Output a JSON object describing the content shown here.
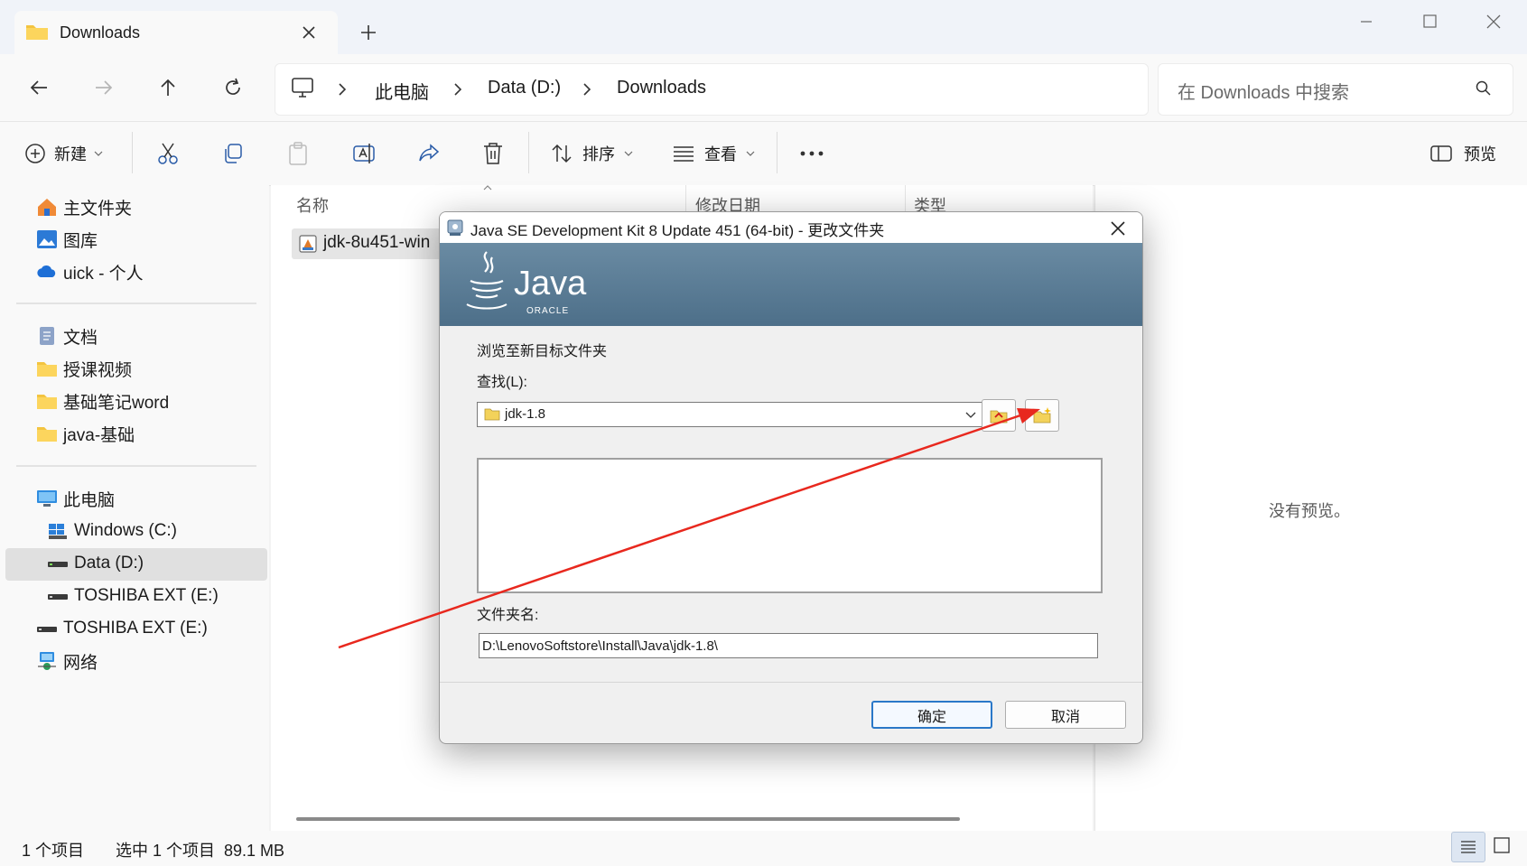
{
  "tab": {
    "title": "Downloads"
  },
  "breadcrumb": [
    "此电脑",
    "Data (D:)",
    "Downloads"
  ],
  "search": {
    "placeholder": "在 Downloads 中搜索"
  },
  "toolbar": {
    "new_label": "新建",
    "sort_label": "排序",
    "view_label": "查看",
    "preview_label": "预览"
  },
  "sidebar": {
    "quick": [
      "主文件夹",
      "图库",
      "uick - 个人"
    ],
    "pinned": [
      "文档",
      "授课视频",
      "基础笔记word",
      "java-基础"
    ],
    "this_pc": "此电脑",
    "drives": [
      "Windows (C:)",
      "Data (D:)",
      "TOSHIBA EXT (E:)"
    ],
    "external": "TOSHIBA EXT (E:)",
    "network": "网络"
  },
  "filelist": {
    "columns": [
      "名称",
      "修改日期",
      "类型"
    ],
    "files": [
      {
        "name": "jdk-8u451-win"
      }
    ]
  },
  "preview": {
    "empty_text": "没有预览。"
  },
  "status": {
    "count": "1 个项目",
    "selection": "选中 1 个项目  89.1 MB"
  },
  "dialog": {
    "title": "Java SE Development Kit 8 Update 451 (64-bit) - 更改文件夹",
    "logo_text": "Java",
    "logo_sub": "ORACLE",
    "browse_label": "浏览至新目标文件夹",
    "lookin_label": "查找(L):",
    "lookin_value": "jdk-1.8",
    "foldername_label": "文件夹名:",
    "foldername_value": "D:\\LenovoSoftstore\\Install\\Java\\jdk-1.8\\",
    "ok": "确定",
    "cancel": "取消"
  },
  "colors": {
    "accent": "#0067c0",
    "banner": "#5a7b94",
    "annotation_arrow": "#e8281e"
  }
}
